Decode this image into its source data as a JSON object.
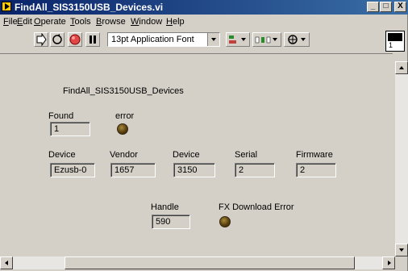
{
  "window": {
    "title": "FindAll_SIS3150USB_Devices.vi"
  },
  "title_buttons": {
    "minimize": "_",
    "maximize": "□",
    "close": "X"
  },
  "menu": [
    "File",
    "Edit",
    "Operate",
    "Tools",
    "Browse",
    "Window",
    "Help"
  ],
  "toolbar": {
    "font_value": "13pt Application Font",
    "icons": [
      "run-arrow-icon",
      "run-continuous-icon",
      "abort-icon",
      "pause-icon",
      "align-icon",
      "distribute-icon",
      "reorder-icon"
    ]
  },
  "vi_icon": {
    "number": "1"
  },
  "panel": {
    "caption": "FindAll_SIS3150USB_Devices",
    "found": {
      "label": "Found",
      "value": "1"
    },
    "error": {
      "label": "error"
    },
    "device_name": {
      "label": "Device",
      "value": "Ezusb-0"
    },
    "vendor": {
      "label": "Vendor",
      "value": "1657"
    },
    "device_id": {
      "label": "Device",
      "value": "3150"
    },
    "serial": {
      "label": "Serial",
      "value": "2"
    },
    "firmware": {
      "label": "Firmware",
      "value": "2"
    },
    "handle": {
      "label": "Handle",
      "value": "590"
    },
    "fx_error": {
      "label": "FX Download Error"
    }
  },
  "colors": {
    "panel": "#d4d0c8",
    "titlebar": "#0a246a",
    "led_off": "#5a4010"
  }
}
